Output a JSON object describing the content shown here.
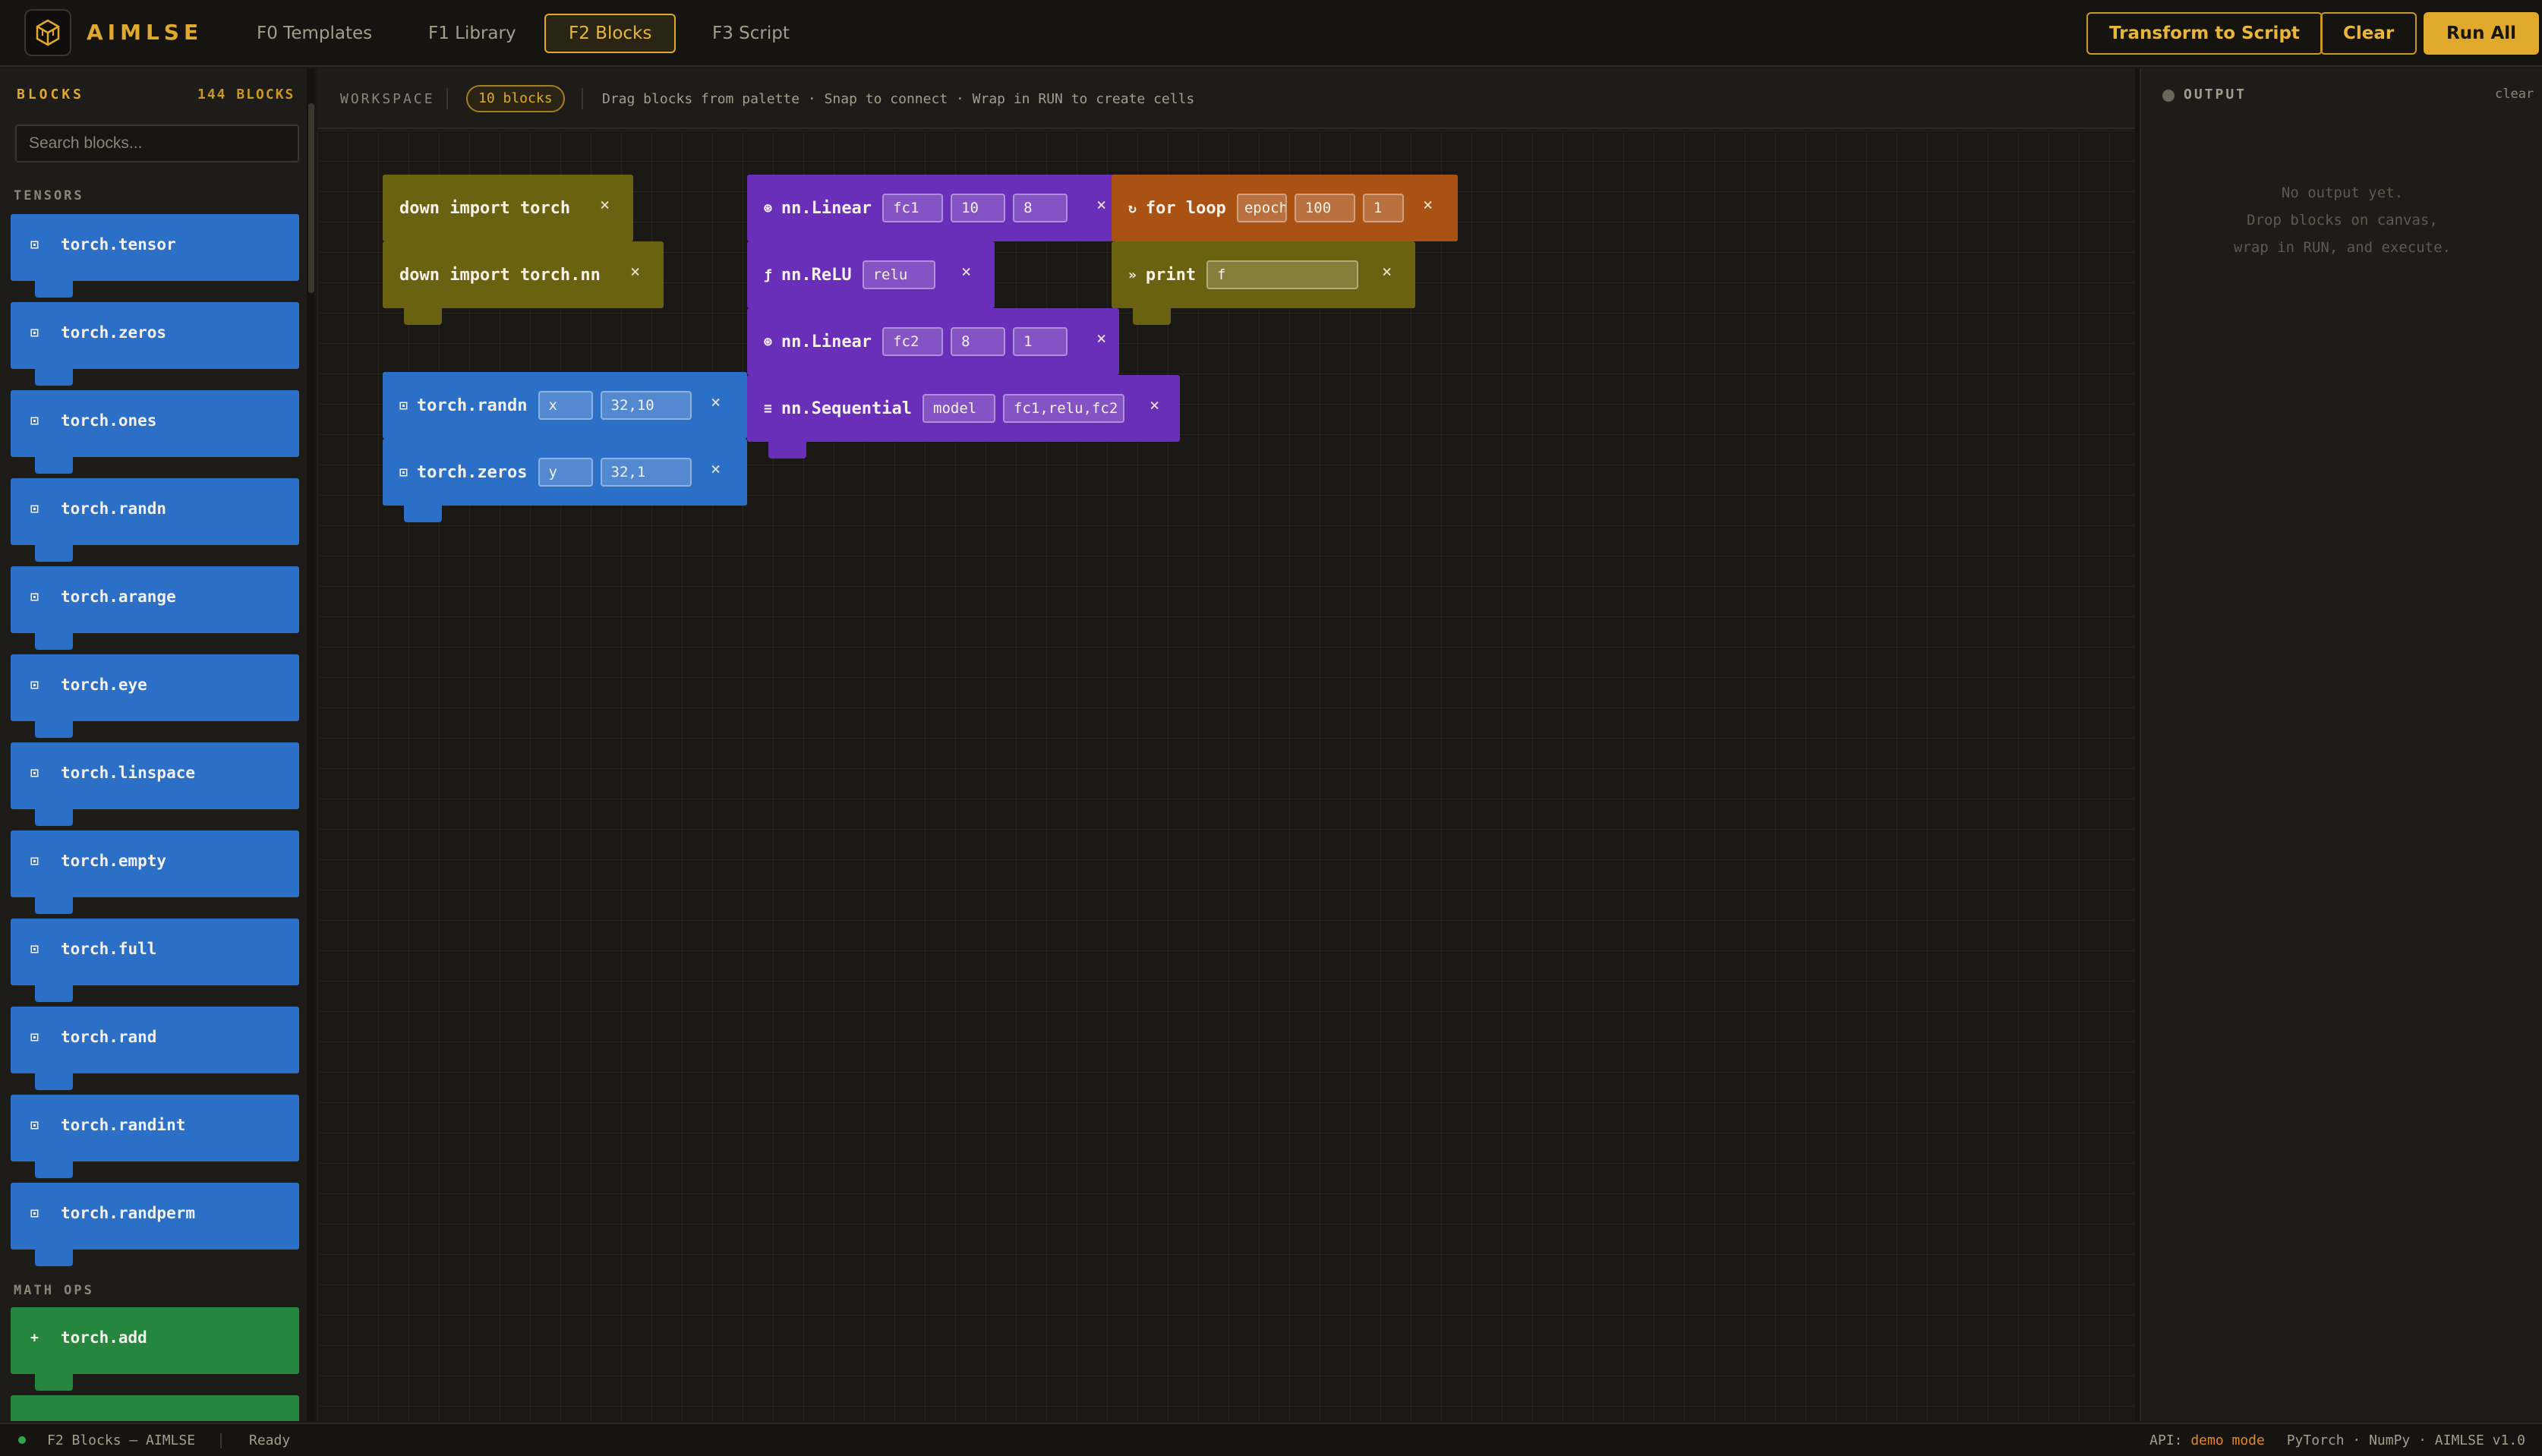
{
  "app": {
    "brand": "AIMLSE",
    "icon": "logo-cube-icon",
    "accent": "#e0a92c"
  },
  "nav": {
    "tabs": [
      {
        "label": "F0 Templates",
        "active": false
      },
      {
        "label": "F1 Library",
        "active": false
      },
      {
        "label": "F2 Blocks",
        "active": true
      },
      {
        "label": "F3 Script",
        "active": false
      }
    ]
  },
  "actions": {
    "transform": "Transform to Script",
    "clear": "Clear",
    "run_all": "Run All"
  },
  "sidebar": {
    "title": "BLOCKS",
    "count": "144 BLOCKS",
    "search_placeholder": "Search blocks...",
    "categories": [
      {
        "name": "TENSORS",
        "color": "#2c6fc6",
        "icon": "⊡",
        "items": [
          "torch.tensor",
          "torch.zeros",
          "torch.ones",
          "torch.randn",
          "torch.arange",
          "torch.eye",
          "torch.linspace",
          "torch.empty",
          "torch.full",
          "torch.rand",
          "torch.randint",
          "torch.randperm"
        ]
      },
      {
        "name": "MATH OPS",
        "color": "#25873e",
        "icon": "+",
        "items": [
          "torch.add",
          ""
        ]
      }
    ]
  },
  "workspace": {
    "label": "WORKSPACE",
    "block_count": "10 blocks",
    "hint": "Drag blocks from palette · Snap to connect · Wrap in RUN to create cells",
    "blocks": [
      {
        "id": "imp1",
        "icon": "",
        "label": "down import torch",
        "fields": [],
        "color": "#6b6211"
      },
      {
        "id": "imp2",
        "icon": "",
        "label": "down import torch.nn",
        "fields": [],
        "color": "#6b6211"
      },
      {
        "id": "randn",
        "icon": "⊡",
        "label": "torch.randn",
        "fields": [
          "x",
          "32,10"
        ],
        "color": "#2c6fc6"
      },
      {
        "id": "zeros",
        "icon": "⊡",
        "label": "torch.zeros",
        "fields": [
          "y",
          "32,1"
        ],
        "color": "#2c6fc6"
      },
      {
        "id": "lin1",
        "icon": "⊛",
        "label": "nn.Linear",
        "fields": [
          "fc1",
          "10",
          "8"
        ],
        "color": "#6a2fb9"
      },
      {
        "id": "relu",
        "icon": "ƒ",
        "label": "nn.ReLU",
        "fields": [
          "relu"
        ],
        "color": "#6a2fb9"
      },
      {
        "id": "lin2",
        "icon": "⊛",
        "label": "nn.Linear",
        "fields": [
          "fc2",
          "8",
          "1"
        ],
        "color": "#6a2fb9"
      },
      {
        "id": "seq",
        "icon": "≡",
        "label": "nn.Sequential",
        "fields": [
          "model",
          "fc1,relu,fc2"
        ],
        "color": "#6a2fb9"
      },
      {
        "id": "loop",
        "icon": "↻",
        "label": "for loop",
        "fields": [
          "epoch",
          "100",
          "1"
        ],
        "color": "#a95214"
      },
      {
        "id": "print",
        "icon": "»",
        "label": "print",
        "fields": [
          "f"
        ],
        "color": "#6b6211"
      }
    ]
  },
  "output": {
    "title": "OUTPUT",
    "clear": "clear",
    "empty_lines": [
      "No output yet.",
      "Drop blocks on canvas,",
      "wrap in RUN, and execute."
    ]
  },
  "status": {
    "left": "F2 Blocks — AIMLSE",
    "state": "Ready",
    "api_label": "API:",
    "api_mode": "demo mode",
    "right": "PyTorch · NumPy · AIMLSE v1.0"
  }
}
